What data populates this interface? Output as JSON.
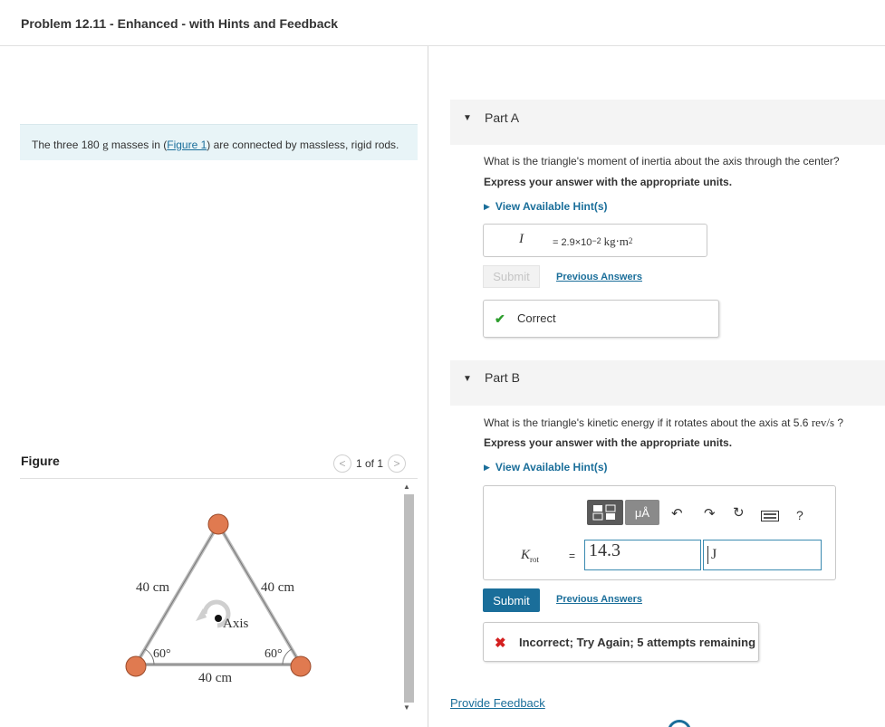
{
  "header": {
    "title": "Problem 12.11 - Enhanced - with Hints and Feedback"
  },
  "intro": {
    "before": "The three 180 ",
    "unit": "g",
    "middle": " masses in (",
    "link": "Figure 1",
    "after": ") are connected by massless, rigid rods."
  },
  "figure": {
    "label": "Figure",
    "pager": "1 of 1",
    "labels": {
      "left_side": "40 cm",
      "right_side": "40 cm",
      "bottom_side": "40 cm",
      "left_angle": "60°",
      "right_angle": "60°",
      "axis": "Axis"
    }
  },
  "partA": {
    "label": "Part A",
    "question": "What is the triangle's moment of inertia about the axis through the center?",
    "express": "Express your answer with the appropriate units.",
    "hint": "View Available Hint(s)",
    "answer_symbol": "I",
    "answer_eq": "=",
    "answer_value": "2.9×10",
    "answer_exp": "−2",
    "answer_unit": "kg⋅m",
    "answer_unit_exp": "2",
    "submit": "Submit",
    "previous": "Previous Answers",
    "result": "Correct"
  },
  "partB": {
    "label": "Part B",
    "question_before": "What is the triangle's kinetic energy if it rotates about the axis at 5.6 ",
    "question_unit": "rev/s",
    "question_after": " ?",
    "express": "Express your answer with the appropriate units.",
    "hint": "View Available Hint(s)",
    "toolbar_units": "μÅ",
    "toolbar_help": "?",
    "answer_symbol": "K",
    "answer_sub": "rot",
    "answer_eq": "=",
    "value": "14.3",
    "unit": "J",
    "submit": "Submit",
    "previous": "Previous Answers",
    "result": "Incorrect; Try Again; 5 attempts remaining"
  },
  "footer": {
    "feedback": "Provide Feedback"
  },
  "colors": {
    "accent": "#1a6e9a",
    "correct": "#2e9e2e",
    "incorrect": "#d42020",
    "mass": "#e07a50"
  }
}
